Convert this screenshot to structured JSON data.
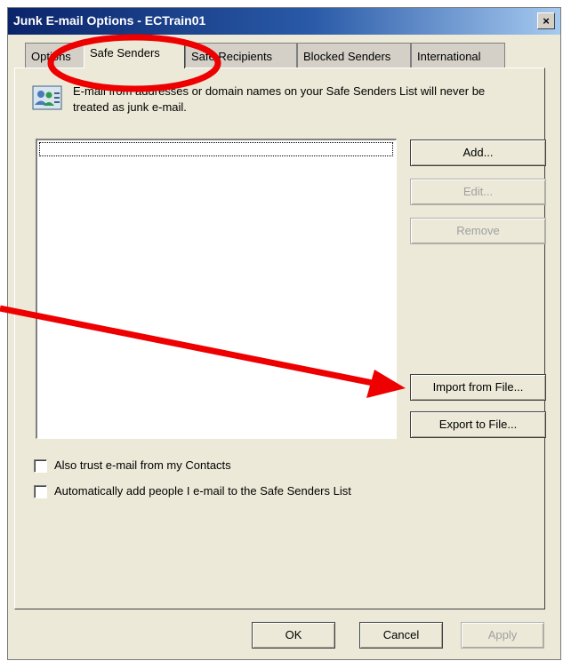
{
  "window": {
    "title": "Junk E-mail Options - ECTrain01",
    "close_label": "×"
  },
  "tabs": [
    {
      "label": "Options",
      "active": false
    },
    {
      "label": "Safe Senders",
      "active": true
    },
    {
      "label": "Safe Recipients",
      "active": false
    },
    {
      "label": "Blocked Senders",
      "active": false
    },
    {
      "label": "International",
      "active": false
    }
  ],
  "info": {
    "icon": "address-book-icon",
    "text": "E-mail from addresses or domain names on your Safe Senders List will never be treated as junk e-mail."
  },
  "buttons": {
    "add": "Add...",
    "edit": "Edit...",
    "remove": "Remove",
    "import": "Import from File...",
    "export": "Export to File..."
  },
  "checkboxes": [
    {
      "label": "Also trust e-mail from my Contacts",
      "checked": false
    },
    {
      "label": "Automatically add people I e-mail to the Safe Senders List",
      "checked": false
    }
  ],
  "footer": {
    "ok": "OK",
    "cancel": "Cancel",
    "apply": "Apply"
  },
  "annotation_color": "#ee0000"
}
